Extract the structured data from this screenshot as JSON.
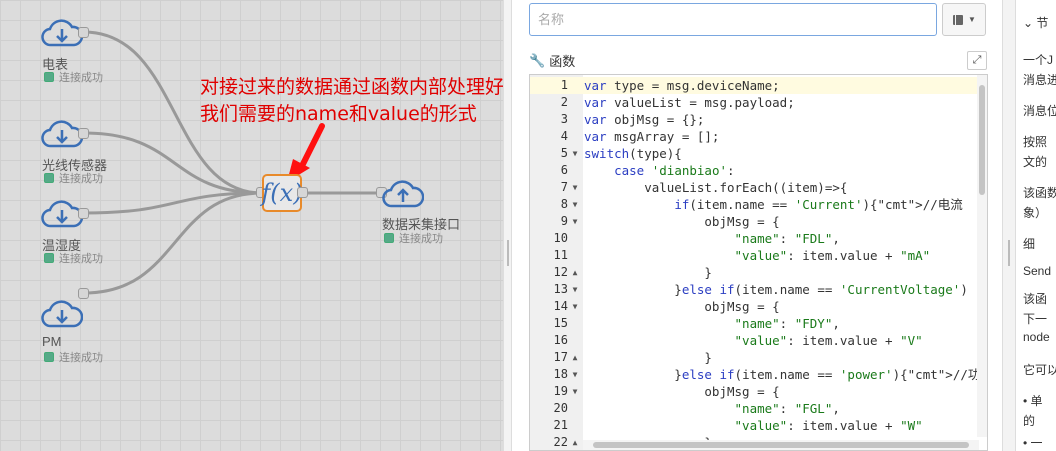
{
  "nodes": [
    {
      "label": "电表",
      "status": "连接成功"
    },
    {
      "label": "光线传感器",
      "status": "连接成功"
    },
    {
      "label": "温湿度",
      "status": "连接成功"
    },
    {
      "label": "PM",
      "status": "连接成功"
    },
    {
      "label": "数据采集接口",
      "status": "连接成功"
    }
  ],
  "function_node": {
    "symbol": "f(x)"
  },
  "annotation": {
    "line1": "对接过来的数据通过函数内部处理好",
    "line2": "我们需要的name和value的形式"
  },
  "editor": {
    "name_placeholder": "名称",
    "function_label": "函数",
    "book_icon": "book-icon",
    "expand_icon": "expand-icon",
    "code_lines": [
      {
        "n": "1",
        "fold": "",
        "text": "var type = msg.deviceName;"
      },
      {
        "n": "2",
        "fold": "",
        "text": "var valueList = msg.payload;"
      },
      {
        "n": "3",
        "fold": "",
        "text": "var objMsg = {};"
      },
      {
        "n": "4",
        "fold": "",
        "text": "var msgArray = [];"
      },
      {
        "n": "5",
        "fold": "▼",
        "text": "switch(type){"
      },
      {
        "n": "6",
        "fold": "",
        "text": "    case 'dianbiao':"
      },
      {
        "n": "7",
        "fold": "▼",
        "text": "        valueList.forEach((item)=>{"
      },
      {
        "n": "8",
        "fold": "▼",
        "text": "            if(item.name == 'Current'){//电流"
      },
      {
        "n": "9",
        "fold": "▼",
        "text": "                objMsg = {"
      },
      {
        "n": "10",
        "fold": "",
        "text": "                    \"name\": \"FDL\","
      },
      {
        "n": "11",
        "fold": "",
        "text": "                    \"value\": item.value + \"mA\""
      },
      {
        "n": "12",
        "fold": "▲",
        "text": "                }"
      },
      {
        "n": "13",
        "fold": "▼",
        "text": "            }else if(item.name == 'CurrentVoltage')"
      },
      {
        "n": "14",
        "fold": "▼",
        "text": "                objMsg = {"
      },
      {
        "n": "15",
        "fold": "",
        "text": "                    \"name\": \"FDY\","
      },
      {
        "n": "16",
        "fold": "",
        "text": "                    \"value\": item.value + \"V\""
      },
      {
        "n": "17",
        "fold": "▲",
        "text": "                }"
      },
      {
        "n": "18",
        "fold": "▼",
        "text": "            }else if(item.name == 'power'){//功率"
      },
      {
        "n": "19",
        "fold": "▼",
        "text": "                objMsg = {"
      },
      {
        "n": "20",
        "fold": "",
        "text": "                    \"name\": \"FGL\","
      },
      {
        "n": "21",
        "fold": "",
        "text": "                    \"value\": item.value + \"W\""
      },
      {
        "n": "22",
        "fold": "▲",
        "text": "                }"
      }
    ]
  },
  "info": {
    "header": "节",
    "lines": [
      "一个J",
      "消息进",
      "消息位",
      "按照",
      "文的",
      "该函数",
      "象）",
      "细",
      "Send",
      "该函",
      "下一",
      "node",
      "它可以",
      "•  单",
      "的",
      "•  一"
    ]
  },
  "colors": {
    "wire": "#999999",
    "function_border": "#e88a2a",
    "node_icon": "#3b6fb6",
    "status": "#55aa88",
    "annotation": "#e00000",
    "arrow": "#ff1010"
  }
}
